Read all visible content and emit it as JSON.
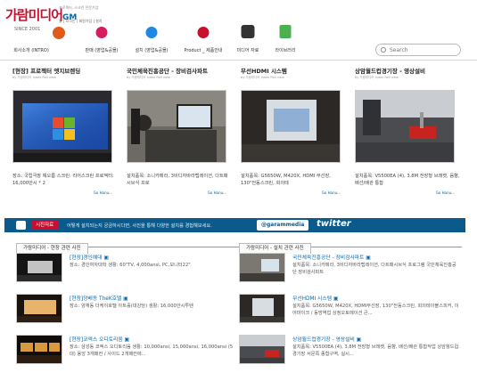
{
  "logo": {
    "name": "가람미디어",
    "gm": "GM",
    "tagline": "프로젝터, 스크린 전문기업",
    "links": "홈 | 로그인 | 회원가입 | 설치",
    "since": "SINCE 2001"
  },
  "menu": {
    "items": [
      {
        "label": "회사소개 (INTRO)",
        "icon": "intro-badge-icon",
        "color": "#e05a1a"
      },
      {
        "label": "판매 (영업&공몰)",
        "icon": "sale-badge-icon",
        "color": "#d81b60"
      },
      {
        "label": "설치 (영업&공몰)",
        "icon": "install-badge-icon",
        "color": "#1e88e5"
      },
      {
        "label": "Product _ 제품안내",
        "icon": "new-badge-icon",
        "color": "#c8102e"
      },
      {
        "label": "미디어 자료",
        "icon": "tv-video-icon",
        "color": "#333333"
      },
      {
        "label": "라이브러리",
        "icon": "book-icon",
        "color": "#4caf50"
      }
    ]
  },
  "search": {
    "placeholder": "Search"
  },
  "cards": [
    {
      "title": "[현장] 프로젝터 엣지브렌딩",
      "subtitle": "by 가람미디어 Index Roll view",
      "desc": "장소: 국립극장 해오름 스크린: 리어스크린 프로젝터: 16,000안시 * 2",
      "more": "Go Hanu..."
    },
    {
      "title": "국민체육진흥공단 - 장비검사파트",
      "subtitle": "by 가람미디어 Index Roll view",
      "desc": "설치품목: 소니카메라, 3비디자바라랩레이션, 다트패시브식 프로",
      "more": "Go Hanu..."
    },
    {
      "title": "무선HDMI 시스템",
      "subtitle": "by 가람미디어 Index Roll view",
      "desc": "설치품목: G5650W, M420X, HDMI 무선장, 130\"전동스크린, 회의테",
      "more": "Go Hanu..."
    },
    {
      "title": "상암월드컵경기장 - 영상설비",
      "subtitle": "by 가람미디어 Index Roll view",
      "desc": "설치품목: V5500EA (4), 3.8M 전장형 브래켓, 음향, 배선/배관 통합",
      "more": "Go Hanu..."
    }
  ],
  "social": {
    "label": "시진자료",
    "text": "어떻게 설치되는지 궁금하시다면, 사진을 통해 다양한 설치를 경험해보세요.",
    "handle": "@garammedia",
    "twitter": "twitter"
  },
  "left_column": {
    "tab": "가람미디어 - 현장 관련 사진",
    "items": [
      {
        "title": "[현장]경인예대 ▣",
        "desc": "장소: 경인여자대학 생활: 60\"TV, 4,000ansi, PC,모니터22\""
      },
      {
        "title": "[현장]양배동 TheK호텔 ▣",
        "desc": "장소: 양재동 더케이호텔 아트홀(대강당) 생활: 16,000안시투텐"
      },
      {
        "title": "[현장]코엑스 오디토리움 ▣",
        "desc": "장소: 삼성동 코엑스 오디토리움 생활: 10,000ansi, 15,000ansi, 16,000ansi (5대) 용앙 3개패컨 / 사이드 2개패컨에..."
      }
    ]
  },
  "right_column": {
    "tab": "가람미디어 - 설치 관련 사진",
    "items": [
      {
        "title": "국민체육진흥공단 - 장비검사파트 ▣",
        "desc": "설치품목: 소니카메라, 3비디자바라랩레이션, 다트패시브식 프로그램 국민체육진흥공단 장비검사파트"
      },
      {
        "title": "무선HDMI 시스템 ▣",
        "desc": "설치품목: G5650W, M420X, HDMI무선장, 130\"전동스크린, 회의테이블스피커, 이어마이크 / 동방역업 상정오토메이션 큰..."
      },
      {
        "title": "상암월드컵경기장 - 영상설비 ▣",
        "desc": "설치품목: V5500EA (4), 3.8M 전장형 브래켓, 음향, 배선/배관 통합작업 상암월드컵경기장 서문쪽 종합구역, 실시..."
      }
    ]
  }
}
